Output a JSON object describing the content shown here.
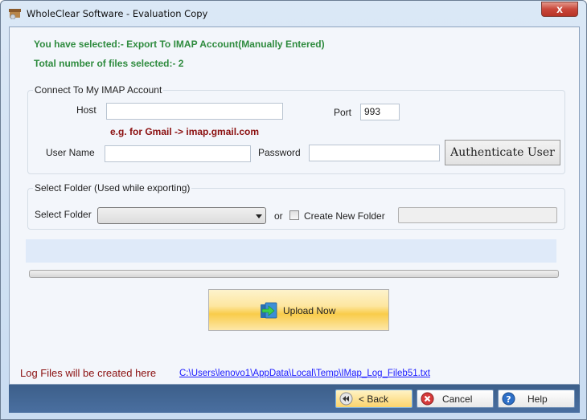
{
  "window": {
    "title": "WholeClear Software - Evaluation Copy",
    "close_label": "x"
  },
  "summary": {
    "selected": "You have selected:- Export To IMAP Account(Manually Entered)",
    "total_files": "Total number of files selected:- 2"
  },
  "imap_group": {
    "legend": "Connect To My IMAP Account",
    "host_label": "Host",
    "host_value": "",
    "port_label": "Port",
    "port_value": "993",
    "hint": "e.g. for Gmail -> imap.gmail.com",
    "username_label": "User Name",
    "username_value": "",
    "password_label": "Password",
    "password_value": "",
    "authenticate_label": "Authenticate User"
  },
  "folder_group": {
    "legend": "Select Folder (Used while exporting)",
    "select_label": "Select Folder",
    "select_value": "",
    "or_label": "or",
    "create_new_label": "Create New Folder",
    "create_new_checked": false,
    "new_folder_value": ""
  },
  "progress": {
    "value_percent": 0
  },
  "upload": {
    "label": "Upload Now"
  },
  "log": {
    "label": "Log Files will be created here",
    "path": "C:\\Users\\lenovo1\\AppData\\Local\\Temp\\IMap_Log_Fileb51.txt"
  },
  "footer": {
    "back_label": "< Back",
    "cancel_label": "Cancel",
    "help_label": "Help"
  },
  "colors": {
    "summary_green": "#2e8b3e",
    "hint_red": "#8b1010",
    "footer_blue": "#4a6fa0",
    "link_blue": "#1a1aff"
  }
}
